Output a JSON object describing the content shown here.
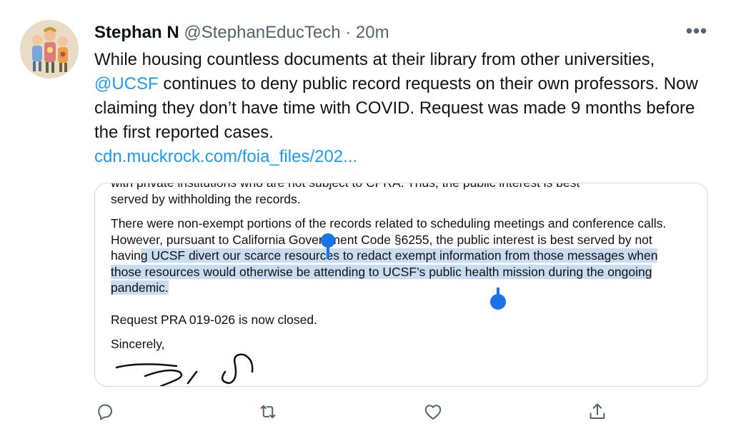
{
  "tweet": {
    "author_name": "Stephan N",
    "handle": "@StephanEducTech",
    "separator": "·",
    "time": "20m",
    "more_label": "•••",
    "text_1": "While housing countless documents at their library from other universities,",
    "mention": "@UCSF",
    "text_2": "continues to deny public record requests on their own professors. Now claiming they don’t have time with COVID. Request was made 9 months before the first reported cases.",
    "link": "cdn.muckrock.com/foia_files/202..."
  },
  "document": {
    "cut_line": "with private institutions who are not subject to CPRA. Thus, the public interest is best",
    "para1": "served by withholding the records.",
    "para2_a": "There were non-exempt portions of the records related to scheduling meetings and conference calls. However, pursuant to California Government Code §6255, the public interest is best served by not havin",
    "para2_b": "g UCSF divert our scarce resources to redact exempt information from those messages when those resources would otherwise be attending to UCSF’s public health mission during the ongoing pandemic.",
    "closing": "Request PRA 019-026 is now closed.",
    "signoff": "Sincerely,"
  },
  "colors": {
    "accent": "#1d9bf0",
    "secondary_text": "#536471",
    "selection": "#c9ddf2",
    "selection_handle": "#1a73e8"
  },
  "icons": [
    "reply-icon",
    "retweet-icon",
    "like-icon",
    "share-icon",
    "more-icon"
  ]
}
